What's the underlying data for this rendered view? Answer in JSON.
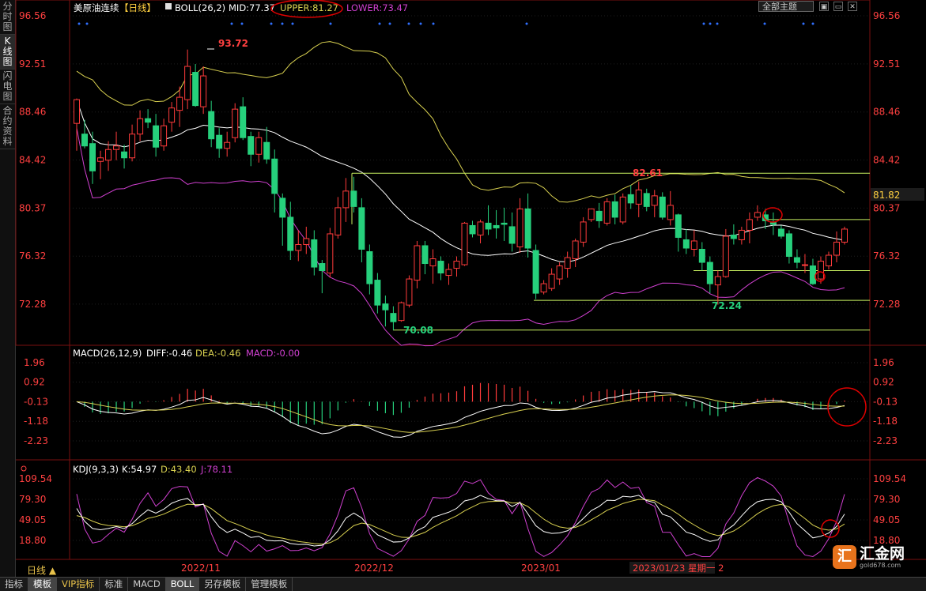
{
  "sidebar": {
    "tabs": [
      "分时图",
      "K线图",
      "闪电图",
      "合约资料"
    ],
    "active": 1
  },
  "header": {
    "instrument": "美原油连续",
    "period_tag": "【日线】",
    "indicator": "BOLL(26,2)",
    "mid": "MID:77.37",
    "upper": "UPPER:81.27",
    "lower": "LOWER:73.47"
  },
  "theme_select": "全部主题",
  "window_buttons": [
    "▣",
    "▭",
    "✕"
  ],
  "colors": {
    "up": "#ff3b3b",
    "down": "#26d07c",
    "mid": "#ffffff",
    "upper": "#d8d050",
    "lower": "#d040d0",
    "axis": "#ff4040",
    "grid": "#1e1e1e",
    "line": "#c8f060"
  },
  "main": {
    "yticks": [
      96.56,
      92.51,
      88.46,
      84.42,
      80.37,
      76.32,
      72.28
    ],
    "ylim": [
      70.0,
      97.5
    ],
    "annotations": [
      "93.72",
      "82.61",
      "72.24",
      "70.08"
    ],
    "last_price": "81.82",
    "hlines": [
      83.3,
      79.4,
      75.1,
      72.6,
      70.1
    ]
  },
  "macd": {
    "title": "MACD(26,12,9)",
    "diff": "DIFF:-0.46",
    "dea": "DEA:-0.46",
    "macd": "MACD:-0.00",
    "yticks": [
      "1.96",
      "0.92",
      "-0.13",
      "-1.18",
      "-2.23"
    ]
  },
  "kdj": {
    "title": "KDJ(9,3,3)",
    "k": "K:54.97",
    "d": "D:43.40",
    "j": "J:78.11",
    "yticks": [
      "109.54",
      "79.30",
      "49.05",
      "18.80"
    ]
  },
  "xaxis": {
    "labels": [
      "2022/11",
      "2022/12",
      "2023/01"
    ],
    "cursor": "2023/01/23 星期一 2"
  },
  "period_label": "日线 ▲",
  "bottom_tabs": [
    "指标",
    "模板",
    "VIP指标",
    "标准",
    "MACD",
    "BOLL",
    "另存模板",
    "管理模板"
  ],
  "logo": {
    "icon": "汇",
    "name": "汇金网",
    "url": "gold678.com"
  },
  "chart_data": {
    "type": "candlestick",
    "title": "美原油连续 日线",
    "x_labels": [
      "2022/11",
      "2022/12",
      "2023/01"
    ],
    "ylim": [
      70.0,
      97.5
    ],
    "candles": [
      [
        87.5,
        89.6,
        85.2,
        89.5
      ],
      [
        86.6,
        87.8,
        85.4,
        85.6
      ],
      [
        85.8,
        86.8,
        82.4,
        83.5
      ],
      [
        84.3,
        85.2,
        82.8,
        84.6
      ],
      [
        84.4,
        86.0,
        83.5,
        85.3
      ],
      [
        85.3,
        86.8,
        84.4,
        85.6
      ],
      [
        85.1,
        85.7,
        83.7,
        84.6
      ],
      [
        84.6,
        87.4,
        84.3,
        86.6
      ],
      [
        86.6,
        88.6,
        86.0,
        87.9
      ],
      [
        87.9,
        88.7,
        87.1,
        87.6
      ],
      [
        87.3,
        88.3,
        84.7,
        85.5
      ],
      [
        85.6,
        87.9,
        85.2,
        87.3
      ],
      [
        87.6,
        89.3,
        86.8,
        88.8
      ],
      [
        88.6,
        90.6,
        87.2,
        89.7
      ],
      [
        89.5,
        93.72,
        88.7,
        92.3
      ],
      [
        91.8,
        92.5,
        88.9,
        89.0
      ],
      [
        88.9,
        92.3,
        88.3,
        91.5
      ],
      [
        88.5,
        89.4,
        85.5,
        86.2
      ],
      [
        86.5,
        87.1,
        84.6,
        85.4
      ],
      [
        85.4,
        86.8,
        84.7,
        85.9
      ],
      [
        86.3,
        89.2,
        85.9,
        88.7
      ],
      [
        88.9,
        89.7,
        86.1,
        86.3
      ],
      [
        86.4,
        86.8,
        83.9,
        84.9
      ],
      [
        84.9,
        86.8,
        84.2,
        86.3
      ],
      [
        85.9,
        87.2,
        84.1,
        84.5
      ],
      [
        84.5,
        85.3,
        80.0,
        81.6
      ],
      [
        81.2,
        81.6,
        77.2,
        79.6
      ],
      [
        79.6,
        80.9,
        76.0,
        76.8
      ],
      [
        76.8,
        78.5,
        75.9,
        77.3
      ],
      [
        77.3,
        78.8,
        76.5,
        77.8
      ],
      [
        77.7,
        78.5,
        74.7,
        75.4
      ],
      [
        75.7,
        76.0,
        73.2,
        75.1
      ],
      [
        74.9,
        78.7,
        74.5,
        78.2
      ],
      [
        78.1,
        81.3,
        77.8,
        80.4
      ],
      [
        80.4,
        82.9,
        79.2,
        81.8
      ],
      [
        81.8,
        83.0,
        80.0,
        80.5
      ],
      [
        80.4,
        81.2,
        75.8,
        76.9
      ],
      [
        76.7,
        77.3,
        73.1,
        74.0
      ],
      [
        74.3,
        74.9,
        71.5,
        72.2
      ],
      [
        72.3,
        73.0,
        70.4,
        71.8
      ],
      [
        71.5,
        72.1,
        70.08,
        70.8
      ],
      [
        70.9,
        72.5,
        70.8,
        72.4
      ],
      [
        72.2,
        74.7,
        72.0,
        74.4
      ],
      [
        74.3,
        77.6,
        73.6,
        77.2
      ],
      [
        77.2,
        77.6,
        74.8,
        75.7
      ],
      [
        75.5,
        76.9,
        74.0,
        76.1
      ],
      [
        75.9,
        76.3,
        74.3,
        74.9
      ],
      [
        74.7,
        75.7,
        73.9,
        75.2
      ],
      [
        75.3,
        76.3,
        74.6,
        75.9
      ],
      [
        75.6,
        79.2,
        75.5,
        79.1
      ],
      [
        78.9,
        79.3,
        77.9,
        78.2
      ],
      [
        78.1,
        79.4,
        77.4,
        79.2
      ],
      [
        79.1,
        80.6,
        78.1,
        78.6
      ],
      [
        78.9,
        80.2,
        77.8,
        78.7
      ],
      [
        79.1,
        80.4,
        77.6,
        79.0
      ],
      [
        78.8,
        80.0,
        76.7,
        77.4
      ],
      [
        77.1,
        81.2,
        76.6,
        80.3
      ],
      [
        80.3,
        81.6,
        76.2,
        77.0
      ],
      [
        76.8,
        77.3,
        72.7,
        73.2
      ],
      [
        73.3,
        74.3,
        73.1,
        74.0
      ],
      [
        73.6,
        75.3,
        73.4,
        74.8
      ],
      [
        74.4,
        75.8,
        73.9,
        75.5
      ],
      [
        75.3,
        76.7,
        74.5,
        76.2
      ],
      [
        76.1,
        77.8,
        75.4,
        77.6
      ],
      [
        77.5,
        79.6,
        77.1,
        79.2
      ],
      [
        79.4,
        80.3,
        79.2,
        80.3
      ],
      [
        80.1,
        80.8,
        78.7,
        79.3
      ],
      [
        79.1,
        81.2,
        78.9,
        80.9
      ],
      [
        80.9,
        81.5,
        79.0,
        79.6
      ],
      [
        79.2,
        81.6,
        79.0,
        81.3
      ],
      [
        81.5,
        82.3,
        80.3,
        80.8
      ],
      [
        80.7,
        82.61,
        79.6,
        81.9
      ],
      [
        81.6,
        82.0,
        80.1,
        80.5
      ],
      [
        80.6,
        81.9,
        79.6,
        81.4
      ],
      [
        81.3,
        81.7,
        79.4,
        79.6
      ],
      [
        79.4,
        81.8,
        78.9,
        80.6
      ],
      [
        79.8,
        79.9,
        76.7,
        77.9
      ],
      [
        77.7,
        78.6,
        76.5,
        77.0
      ],
      [
        76.9,
        78.5,
        76.3,
        77.6
      ],
      [
        76.9,
        77.5,
        75.1,
        75.8
      ],
      [
        75.8,
        76.3,
        73.2,
        74.0
      ],
      [
        73.9,
        75.1,
        72.24,
        74.6
      ],
      [
        74.6,
        78.6,
        74.5,
        78.0
      ],
      [
        78.1,
        79.0,
        77.3,
        77.8
      ],
      [
        77.7,
        78.8,
        77.3,
        78.5
      ],
      [
        78.5,
        80.0,
        77.4,
        79.4
      ],
      [
        79.6,
        80.6,
        79.3,
        80.0
      ],
      [
        79.8,
        80.3,
        78.6,
        79.3
      ],
      [
        79.2,
        80.0,
        78.1,
        79.0
      ],
      [
        78.6,
        78.9,
        77.8,
        78.0
      ],
      [
        78.2,
        78.5,
        75.7,
        76.3
      ],
      [
        76.2,
        76.9,
        75.3,
        75.8
      ],
      [
        75.6,
        76.5,
        74.9,
        75.6
      ],
      [
        75.5,
        76.1,
        73.9,
        74.0
      ],
      [
        74.4,
        76.3,
        74.0,
        75.9
      ],
      [
        75.5,
        76.7,
        75.2,
        76.4
      ],
      [
        76.4,
        78.4,
        75.8,
        77.5
      ],
      [
        77.5,
        78.8,
        77.3,
        78.6
      ]
    ]
  }
}
